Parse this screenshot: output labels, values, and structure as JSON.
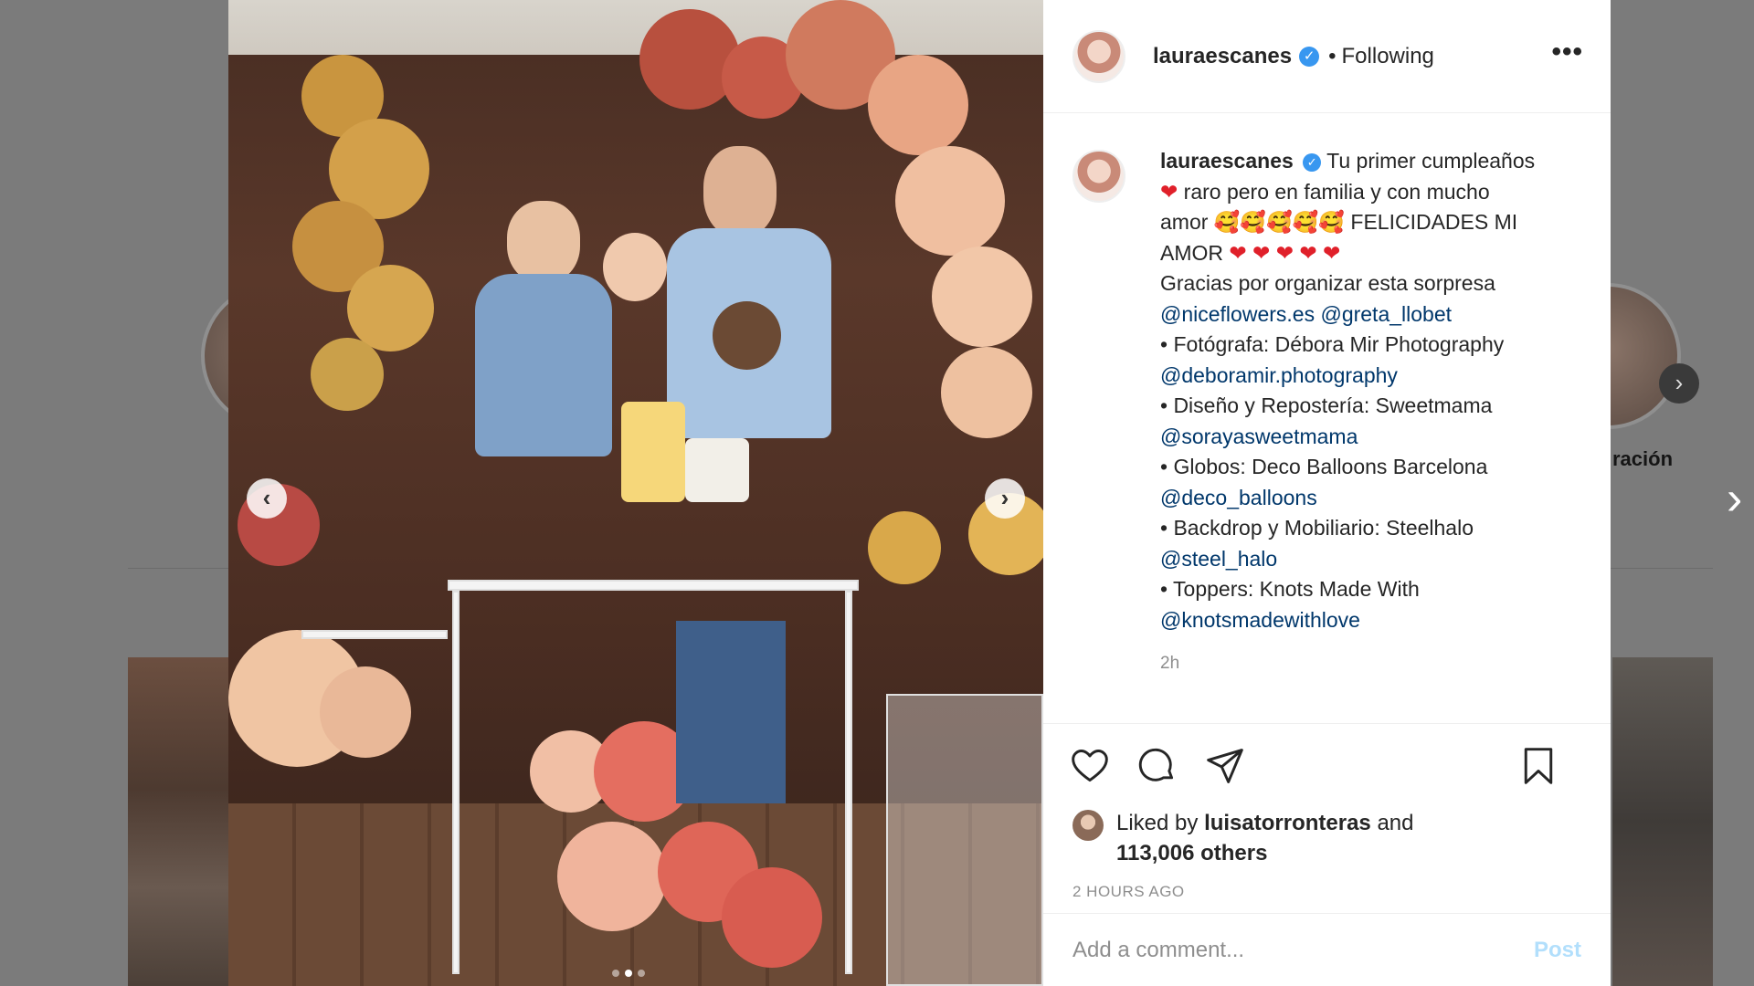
{
  "background": {
    "story_label": "ración"
  },
  "post": {
    "username": "lauraescanes",
    "follow_status": "Following",
    "separator": "•",
    "more_label": "•••",
    "caption": {
      "username": "lauraescanes",
      "line1": "Tu primer cumpleaños",
      "line2": "raro pero en familia y con mucho",
      "line3_start": "amor",
      "line3_end": "FELICIDADES MI",
      "line4": "AMOR",
      "line5": "Gracias por organizar esta sorpresa",
      "mention1": "@niceflowers.es",
      "mention2": "@greta_llobet",
      "line7": "• Fotógrafa: Débora Mir Photography",
      "mention3": "@deboramir.photography",
      "line9": "• Diseño y Repostería: Sweetmama",
      "mention4": "@sorayasweetmama",
      "line11": "• Globos: Deco Balloons Barcelona",
      "mention5": "@deco_balloons",
      "line13": "• Backdrop y Mobiliario: Steelhalo",
      "mention6": "@steel_halo",
      "line15": "• Toppers: Knots Made With",
      "mention7": "@knotsmadewithlove"
    },
    "caption_time": "2h",
    "likes": {
      "prefix": "Liked by",
      "user": "luisatorronteras",
      "and": "and",
      "count": "113,006 others"
    },
    "posted_time": "2 HOURS AGO",
    "comment_placeholder": "Add a comment...",
    "post_label": "Post"
  },
  "carousel": {
    "prev_label": "‹",
    "next_label": "›",
    "slides": 3,
    "active_slide": 2
  },
  "colors": {
    "verified": "#3897f0",
    "mention": "#00376b",
    "post_button": "#b2dffc"
  }
}
